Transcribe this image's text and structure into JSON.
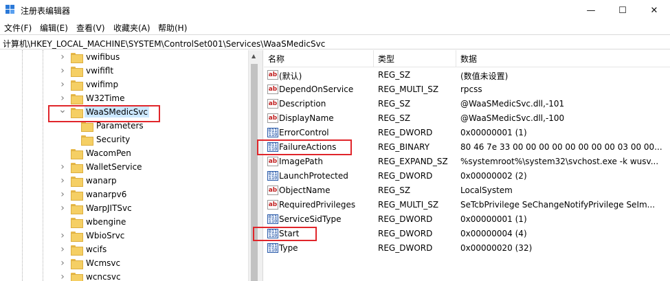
{
  "window": {
    "title": "注册表编辑器",
    "minimize_glyph": "—",
    "maximize_glyph": "☐",
    "close_glyph": "✕"
  },
  "menu": [
    "文件(F)",
    "编辑(E)",
    "查看(V)",
    "收藏夹(A)",
    "帮助(H)"
  ],
  "address": "计算机\\HKEY_LOCAL_MACHINE\\SYSTEM\\ControlSet001\\Services\\WaaSMedicSvc",
  "tree": {
    "items": [
      {
        "label": "vwifibus",
        "depth": 0,
        "expander": "collapsed"
      },
      {
        "label": "vwififlt",
        "depth": 0,
        "expander": "collapsed"
      },
      {
        "label": "vwifimp",
        "depth": 0,
        "expander": "collapsed"
      },
      {
        "label": "W32Time",
        "depth": 0,
        "expander": "collapsed"
      },
      {
        "label": "WaaSMedicSvc",
        "depth": 0,
        "expander": "expanded",
        "selected": true
      },
      {
        "label": "Parameters",
        "depth": 1,
        "expander": "none"
      },
      {
        "label": "Security",
        "depth": 1,
        "expander": "none"
      },
      {
        "label": "WacomPen",
        "depth": 0,
        "expander": "none"
      },
      {
        "label": "WalletService",
        "depth": 0,
        "expander": "collapsed"
      },
      {
        "label": "wanarp",
        "depth": 0,
        "expander": "collapsed"
      },
      {
        "label": "wanarpv6",
        "depth": 0,
        "expander": "collapsed"
      },
      {
        "label": "WarpJITSvc",
        "depth": 0,
        "expander": "collapsed"
      },
      {
        "label": "wbengine",
        "depth": 0,
        "expander": "none"
      },
      {
        "label": "WbioSrvc",
        "depth": 0,
        "expander": "collapsed"
      },
      {
        "label": "wcifs",
        "depth": 0,
        "expander": "collapsed"
      },
      {
        "label": "Wcmsvc",
        "depth": 0,
        "expander": "collapsed"
      },
      {
        "label": "wcncsvc",
        "depth": 0,
        "expander": "collapsed"
      }
    ]
  },
  "list": {
    "columns": [
      "名称",
      "类型",
      "数据"
    ],
    "rows": [
      {
        "name": "(默认)",
        "type": "REG_SZ",
        "data": "(数值未设置)",
        "icon": "string-value-icon"
      },
      {
        "name": "DependOnService",
        "type": "REG_MULTI_SZ",
        "data": "rpcss",
        "icon": "string-value-icon"
      },
      {
        "name": "Description",
        "type": "REG_SZ",
        "data": "@WaaSMedicSvc.dll,-101",
        "icon": "string-value-icon"
      },
      {
        "name": "DisplayName",
        "type": "REG_SZ",
        "data": "@WaaSMedicSvc.dll,-100",
        "icon": "string-value-icon"
      },
      {
        "name": "ErrorControl",
        "type": "REG_DWORD",
        "data": "0x00000001 (1)",
        "icon": "binary-value-icon"
      },
      {
        "name": "FailureActions",
        "type": "REG_BINARY",
        "data": "80 46 7e 33 00 00 00 00 00 00 00 00 03 00 00...",
        "icon": "binary-value-icon"
      },
      {
        "name": "ImagePath",
        "type": "REG_EXPAND_SZ",
        "data": "%systemroot%\\system32\\svchost.exe -k wusv...",
        "icon": "string-value-icon"
      },
      {
        "name": "LaunchProtected",
        "type": "REG_DWORD",
        "data": "0x00000002 (2)",
        "icon": "binary-value-icon"
      },
      {
        "name": "ObjectName",
        "type": "REG_SZ",
        "data": "LocalSystem",
        "icon": "string-value-icon"
      },
      {
        "name": "RequiredPrivileges",
        "type": "REG_MULTI_SZ",
        "data": "SeTcbPrivilege SeChangeNotifyPrivilege SeIm...",
        "icon": "string-value-icon"
      },
      {
        "name": "ServiceSidType",
        "type": "REG_DWORD",
        "data": "0x00000001 (1)",
        "icon": "binary-value-icon"
      },
      {
        "name": "Start",
        "type": "REG_DWORD",
        "data": "0x00000004 (4)",
        "icon": "binary-value-icon"
      },
      {
        "name": "Type",
        "type": "REG_DWORD",
        "data": "0x00000020 (32)",
        "icon": "binary-value-icon"
      }
    ]
  },
  "icons": {
    "string_glyph": "ab",
    "binary_glyph": "011\n110"
  },
  "colors": {
    "highlight_box": "#e0252a",
    "selection": "#cce8ff",
    "folder": "#f5cf64"
  }
}
